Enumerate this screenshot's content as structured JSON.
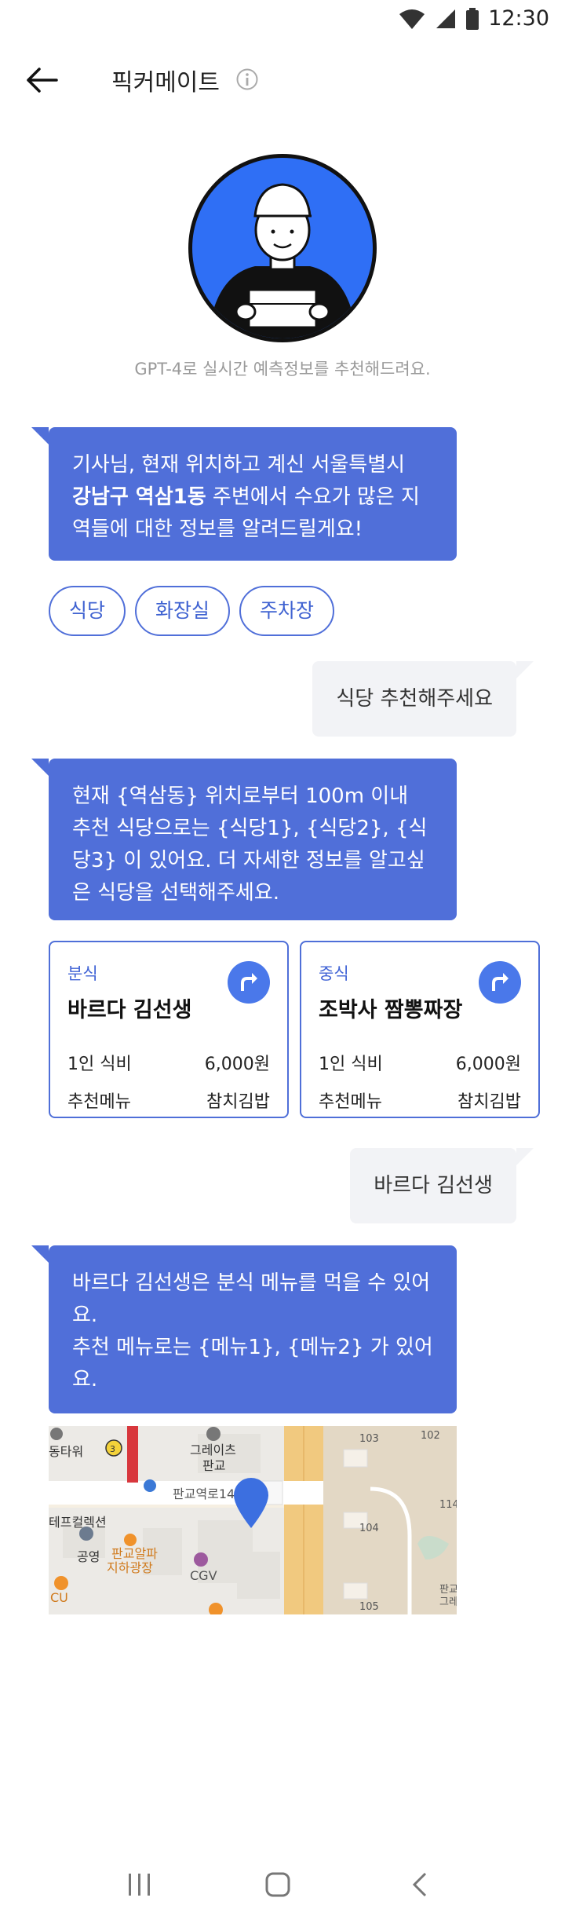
{
  "status_bar": {
    "time": "12:30"
  },
  "header": {
    "title": "픽커메이트"
  },
  "intro": {
    "text": "GPT-4로 실시간 예측정보를 추천해드려요."
  },
  "messages": {
    "bot1": {
      "line1": "기사님, 현재 위치하고 계신 서울특별시",
      "bold": "강남구 역삼1동",
      "rest": " 주변에서 수요가 많은 지역들에 대한 정보를 알려드릴게요!"
    },
    "chips": [
      "식당",
      "화장실",
      "주차장"
    ],
    "user1": "식당 추천해주세요",
    "bot2": "현재 {역삼동} 위치로부터 100m 이내 추천 식당으로는 {식당1}, {식당2}, {식당3} 이 있어요. 더 자세한 정보를 알고싶은 식당을 선택해주세요.",
    "user2": "바르다 김선생",
    "bot3_line1": "바르다 김선생은 분식 메뉴를 먹을 수 있어요.",
    "bot3_line2": "추천 메뉴로는 {메뉴1}, {메뉴2} 가 있어요."
  },
  "cards": [
    {
      "category": "분식",
      "name": "바르다 김선생",
      "row1_label": "1인 식비",
      "row1_value": "6,000원",
      "row2_label": "추천메뉴",
      "row2_value": "참치김밥"
    },
    {
      "category": "중식",
      "name": "조박사 짬뽕짜장",
      "row1_label": "1인 식비",
      "row1_value": "6,000원",
      "row2_label": "추천메뉴",
      "row2_value": "참치김밥"
    }
  ],
  "map": {
    "labels": {
      "tower": "동타워",
      "greatis": "그레이츠",
      "pangyo": "판교",
      "road": "판교역로14",
      "collection": "테프컬렉션",
      "parking": "공영",
      "square": "판교알파",
      "square2": "지하광장",
      "cgv": "CGV",
      "cu": "CU",
      "b103": "103",
      "b102": "102",
      "b104": "104",
      "b105": "105",
      "b114": "114",
      "pangyo_r": "판교",
      "pangyo_r2": "그레",
      "line_num": "3"
    }
  },
  "colors": {
    "primary": "#506fd9",
    "user_bubble": "#f2f3f6",
    "avatar_bg": "#2f6ff5"
  }
}
